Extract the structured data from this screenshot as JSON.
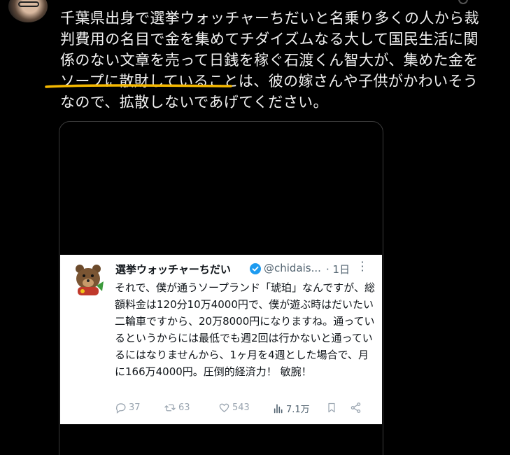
{
  "header": {
    "author_fragment": "",
    "meta_fragment": ""
  },
  "tweet": {
    "text_line_1": "千葉県出身で選挙ウォッチャーちだいと名乗り多くの人から裁",
    "text_line_2": "判費用の名目で金を集めてチダイズムなる大して国民生活に関",
    "text_line_3": "係のない文章を売って日銭を稼ぐ石渡くん智大が、集めた金を",
    "text_line_4_highlight": "ソープに散財している",
    "text_line_4_rest": "ことは、彼の嫁さんや子供がかわいそう",
    "text_line_5": "なので、拡散しないであげてください。",
    "highlight_color": "#f5b800"
  },
  "quoted": {
    "display_name": "選挙ウォッチャーちだい",
    "handle": "@chidais...",
    "time": "· 1日",
    "body": "それで、僕が通うソープランド「琥珀」なんですが、総額料金は120分10万4000円で、僕が遊ぶ時はだいたい二輪車ですから、20万8000円になりますね。通っているというからには最低でも週2回は行かないと通っているにはなりませんから、1ヶ月を4週とした場合で、月に166万4000円。圧倒的経済力！ 敏腕！",
    "replies": "37",
    "retweets": "63",
    "likes": "543",
    "views": "7.1万",
    "verified_color": "#1d9bf0"
  },
  "icons": {
    "reply": "reply-icon",
    "retweet": "retweet-icon",
    "like": "heart-icon",
    "views": "views-icon",
    "bookmark": "bookmark-icon",
    "share": "share-icon",
    "verified": "verified-badge-icon",
    "more": "more-options-icon"
  }
}
